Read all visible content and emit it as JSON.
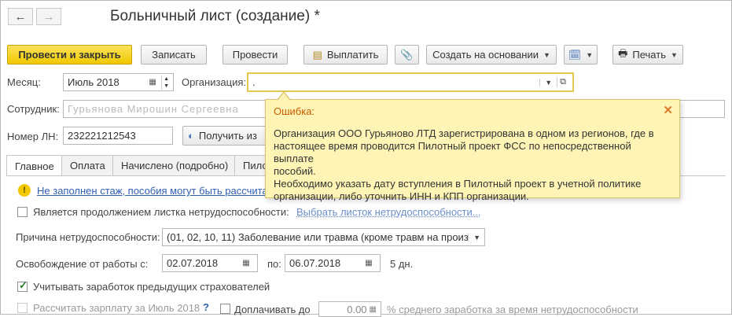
{
  "window": {
    "title": "Больничный лист (создание) *",
    "back_icon": "arrow-left-icon",
    "forward_icon": "arrow-right-icon"
  },
  "toolbar": {
    "post_and_close": "Провести и закрыть",
    "save": "Записать",
    "post": "Провести",
    "pay": "Выплатить",
    "create_based_on": "Создать на основании",
    "print": "Печать"
  },
  "form": {
    "month_label": "Месяц:",
    "month_value": "Июль 2018",
    "org_label": "Организация:",
    "org_value": ".",
    "employee_label": "Сотрудник:",
    "employee_value": "Гурьянова Мирошин Сергеевна",
    "ln_label": "Номер ЛН:",
    "ln_value": "232221212543",
    "get_button": "Получить из"
  },
  "tabs": [
    {
      "label": "Главное",
      "active": true
    },
    {
      "label": "Оплата",
      "active": false
    },
    {
      "label": "Начислено (подробно)",
      "active": false
    },
    {
      "label": "Пило",
      "active": false
    }
  ],
  "main": {
    "warning_link": "Не заполнен стаж, пособия могут быть рассчита",
    "continuation_label": "Является продолжением листка нетрудоспособности:",
    "choose_sheet_link": "Выбрать листок нетрудоспособности...",
    "cause_label": "Причина нетрудоспособности:",
    "cause_value": "(01, 02, 10, 11) Заболевание или травма (кроме травм на произв",
    "release_label": "Освобождение от работы с:",
    "release_from": "02.07.2018",
    "release_to_label": "по:",
    "release_to": "06.07.2018",
    "days": "5 дн.",
    "consider_earnings_label": "Учитывать заработок предыдущих страхователей",
    "consider_earnings_checked": true,
    "calc_salary_label": "Рассчитать зарплату за Июль 2018",
    "help_mark": "?",
    "pay_up_label": "Доплачивать до",
    "pay_up_value": "0.00",
    "avg_earnings_label": "% среднего заработка за время нетрудоспособности"
  },
  "error_popup": {
    "title": "Ошибка:",
    "message_lines": [
      "Организация ООО Гурьяново ЛТД зарегистрирована в одном из регионов, где в",
      "настоящее время проводится Пилотный проект ФСС по непосредственной выплате",
      "пособий.",
      "Необходимо указать дату вступления в Пилотный проект в учетной политике",
      "организации, либо уточнить ИНН и КПП организации."
    ]
  },
  "colors": {
    "primary_button": "#f0c800",
    "popup_bg": "#fdf4b5",
    "popup_title": "#c85a00",
    "link": "#2f5fb3"
  }
}
